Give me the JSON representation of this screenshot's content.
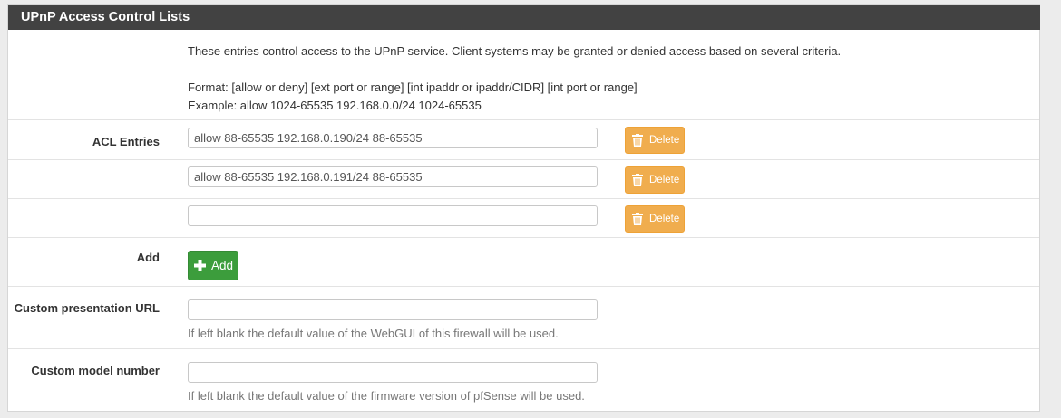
{
  "panel": {
    "title": "UPnP Access Control Lists"
  },
  "intro": {
    "description": "These entries control access to the UPnP service. Client systems may be granted or denied access based on several criteria.",
    "format": "Format: [allow or deny] [ext port or range] [int ipaddr or ipaddr/CIDR] [int port or range]",
    "example": "Example: allow 1024-65535 192.168.0.0/24 1024-65535"
  },
  "acl": {
    "label": "ACL Entries",
    "entries": [
      {
        "value": "allow 88-65535 192.168.0.190/24 88-65535",
        "delete_label": "Delete"
      },
      {
        "value": "allow 88-65535 192.168.0.191/24 88-65535",
        "delete_label": "Delete"
      },
      {
        "value": "",
        "delete_label": "Delete"
      }
    ]
  },
  "add": {
    "label": "Add",
    "button_label": "Add"
  },
  "presentation_url": {
    "label": "Custom presentation URL",
    "value": "",
    "help": "If left blank the default value of the WebGUI of this firewall will be used."
  },
  "model_number": {
    "label": "Custom model number",
    "value": "",
    "help": "If left blank the default value of the firmware version of pfSense will be used."
  },
  "colors": {
    "heading_bg": "#424242",
    "delete_btn": "#f0ad4e",
    "add_btn": "#3c9d3c"
  }
}
